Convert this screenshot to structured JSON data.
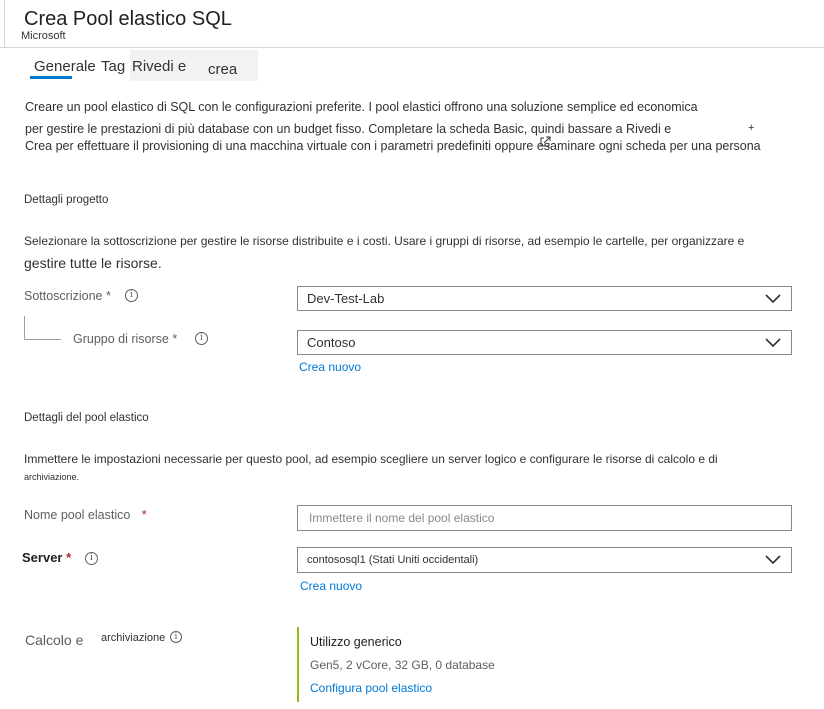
{
  "header": {
    "title": "Crea Pool elastico SQL",
    "publisher": "Microsoft"
  },
  "tabs": [
    {
      "label": "Generale",
      "selected": true
    },
    {
      "label": "Tag",
      "selected": false
    },
    {
      "label": "Rivedi e",
      "selected": false
    },
    {
      "label": "crea",
      "selected": false
    }
  ],
  "intro": {
    "line1": "Creare un pool elastico di SQL con le configurazioni preferite. I pool elastici offrono una soluzione semplice ed economica",
    "line2": "per gestire le prestazioni di più database con un budget fisso. Completare la scheda Basic, quindi bassare a Rivedi e",
    "plus": "+",
    "line3": "Crea per effettuare il provisioning di una macchina virtuale con i parametri predefiniti oppure esaminare ogni scheda per una persona"
  },
  "project": {
    "title": "Dettagli progetto",
    "desc_line1": "Selezionare la sottoscrizione per gestire le risorse distribuite e i costi. Usare i gruppi di risorse, ad esempio le cartelle, per organizzare e",
    "desc_line2": "gestire tutte le risorse.",
    "subscription_label": "Sottoscrizione *",
    "subscription_value": "Dev-Test-Lab",
    "rg_label": "Gruppo di risorse *",
    "rg_value": "Contoso",
    "rg_create_new": "Crea nuovo"
  },
  "pool": {
    "title": "Dettagli del pool elastico",
    "desc_line1": "Immettere le impostazioni necessarie per questo pool, ad esempio scegliere un server logico e configurare le risorse di calcolo e di",
    "desc_line2": "archiviazione.",
    "name_label": "Nome pool elastico",
    "name_required": "*",
    "name_placeholder": "Immettere il nome del pool elastico",
    "server_label": "Server",
    "server_required": "*",
    "server_value": "contososql1 (Stati Uniti occidentali)",
    "server_create_new": "Crea nuovo",
    "compute_label_a": "Calcolo e",
    "compute_label_b": "archiviazione",
    "compute_title": "Utilizzo generico",
    "compute_detail": "Gen5, 2 vCore, 32 GB, 0 database",
    "compute_link": "Configura pool elastico"
  },
  "colors": {
    "accent": "#0078d4",
    "required": "#a4262c",
    "compute_bar": "#8cbd18"
  },
  "icons": [
    "info-icon",
    "chevron-down-icon",
    "external-link-icon"
  ]
}
